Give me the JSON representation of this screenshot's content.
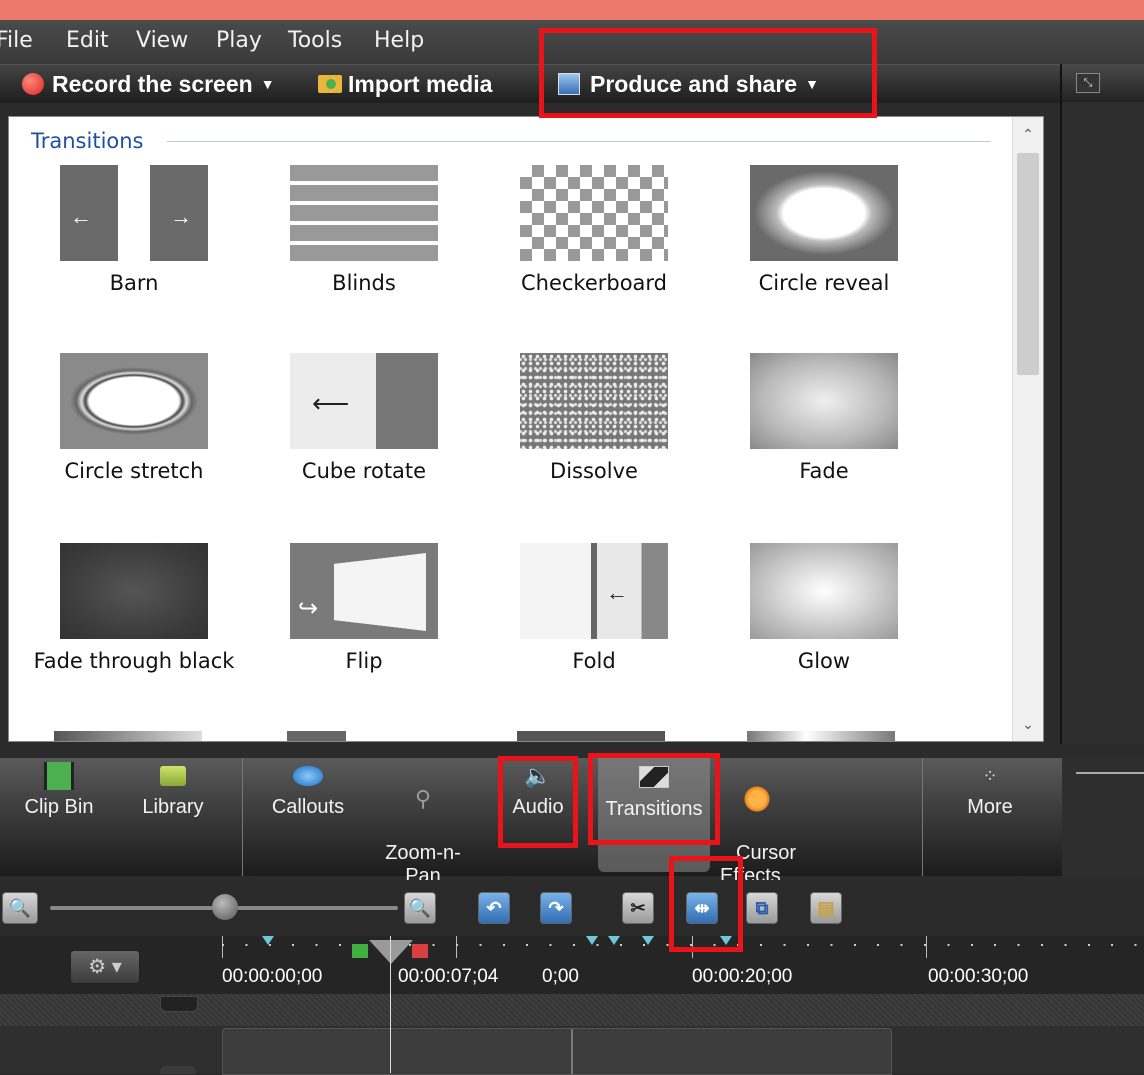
{
  "menu": [
    "File",
    "Edit",
    "View",
    "Play",
    "Tools",
    "Help"
  ],
  "toolbar": {
    "record": "Record the screen",
    "import": "Import media",
    "produce": "Produce and share"
  },
  "transitions": {
    "group_title": "Transitions",
    "items": [
      "Barn",
      "Blinds",
      "Checkerboard",
      "Circle reveal",
      "Circle stretch",
      "Cube rotate",
      "Dissolve",
      "Fade",
      "Fade through black",
      "Flip",
      "Fold",
      "Glow"
    ]
  },
  "tabs": [
    {
      "label": "Clip Bin",
      "icon": "film-strip-icon"
    },
    {
      "label": "Library",
      "icon": "folder-icon"
    },
    {
      "label": "Callouts",
      "icon": "speech-bubble-icon"
    },
    {
      "label": "Zoom-n-\nPan",
      "icon": "magnifier-icon"
    },
    {
      "label": "Audio",
      "icon": "speaker-icon"
    },
    {
      "label": "Transitions",
      "icon": "transition-icon"
    },
    {
      "label": "Cursor\nEffects",
      "icon": "cursor-icon"
    },
    {
      "label": "More",
      "icon": "dots-icon"
    }
  ],
  "selected_tab": "Transitions",
  "timeline": {
    "time_labels": [
      "00:00:00;00",
      "00:00:07;04",
      "0;00",
      "00:00:20;00",
      "00:00:30;00"
    ]
  },
  "colors": {
    "highlight": "#e8141a",
    "group_title": "#1f4fa0",
    "top_strip": "#ec7a6c"
  }
}
